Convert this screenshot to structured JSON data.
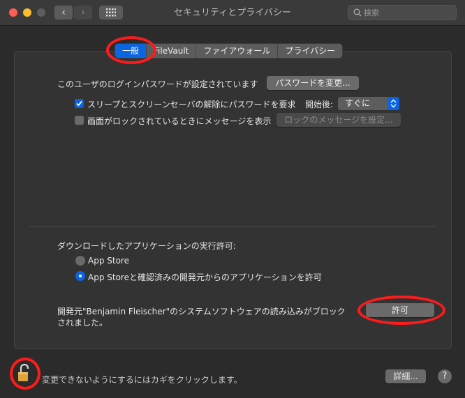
{
  "window": {
    "title": "セキュリティとプライバシー",
    "search_placeholder": "検索",
    "back_icon": "chevron-left-icon",
    "forward_icon": "chevron-right-icon"
  },
  "tabs": [
    {
      "label": "一般",
      "active": true
    },
    {
      "label": "FileVault",
      "active": false
    },
    {
      "label": "ファイアウォール",
      "active": false
    },
    {
      "label": "プライバシー",
      "active": false
    }
  ],
  "general": {
    "password_set_text": "このユーザのログインパスワードが設定されています",
    "change_password_button": "パスワードを変更...",
    "require_password": {
      "label": "スリープとスクリーンセーバの解除にパスワードを要求",
      "checked": true,
      "after_label": "開始後:",
      "after_value": "すぐに"
    },
    "lock_message": {
      "label": "画面がロックされているときにメッセージを表示",
      "checked": false,
      "button": "ロックのメッセージを設定..."
    }
  },
  "downloads": {
    "heading": "ダウンロードしたアプリケーションの実行許可:",
    "options": [
      {
        "label": "App Store",
        "selected": false
      },
      {
        "label": "App Storeと確認済みの開発元からのアプリケーションを許可",
        "selected": true
      }
    ],
    "blocked_line1": "開発元\"Benjamin Fleischer\"のシステムソフトウェアの読み込みがブロック",
    "blocked_line2": "されました。",
    "allow_button": "許可"
  },
  "footer": {
    "lock_text": "変更できないようにするにはカギをクリックします。",
    "advanced_button": "詳細...",
    "help_button": "?"
  },
  "colors": {
    "accent": "#0b64e0",
    "highlight": "#ff1b1b"
  }
}
